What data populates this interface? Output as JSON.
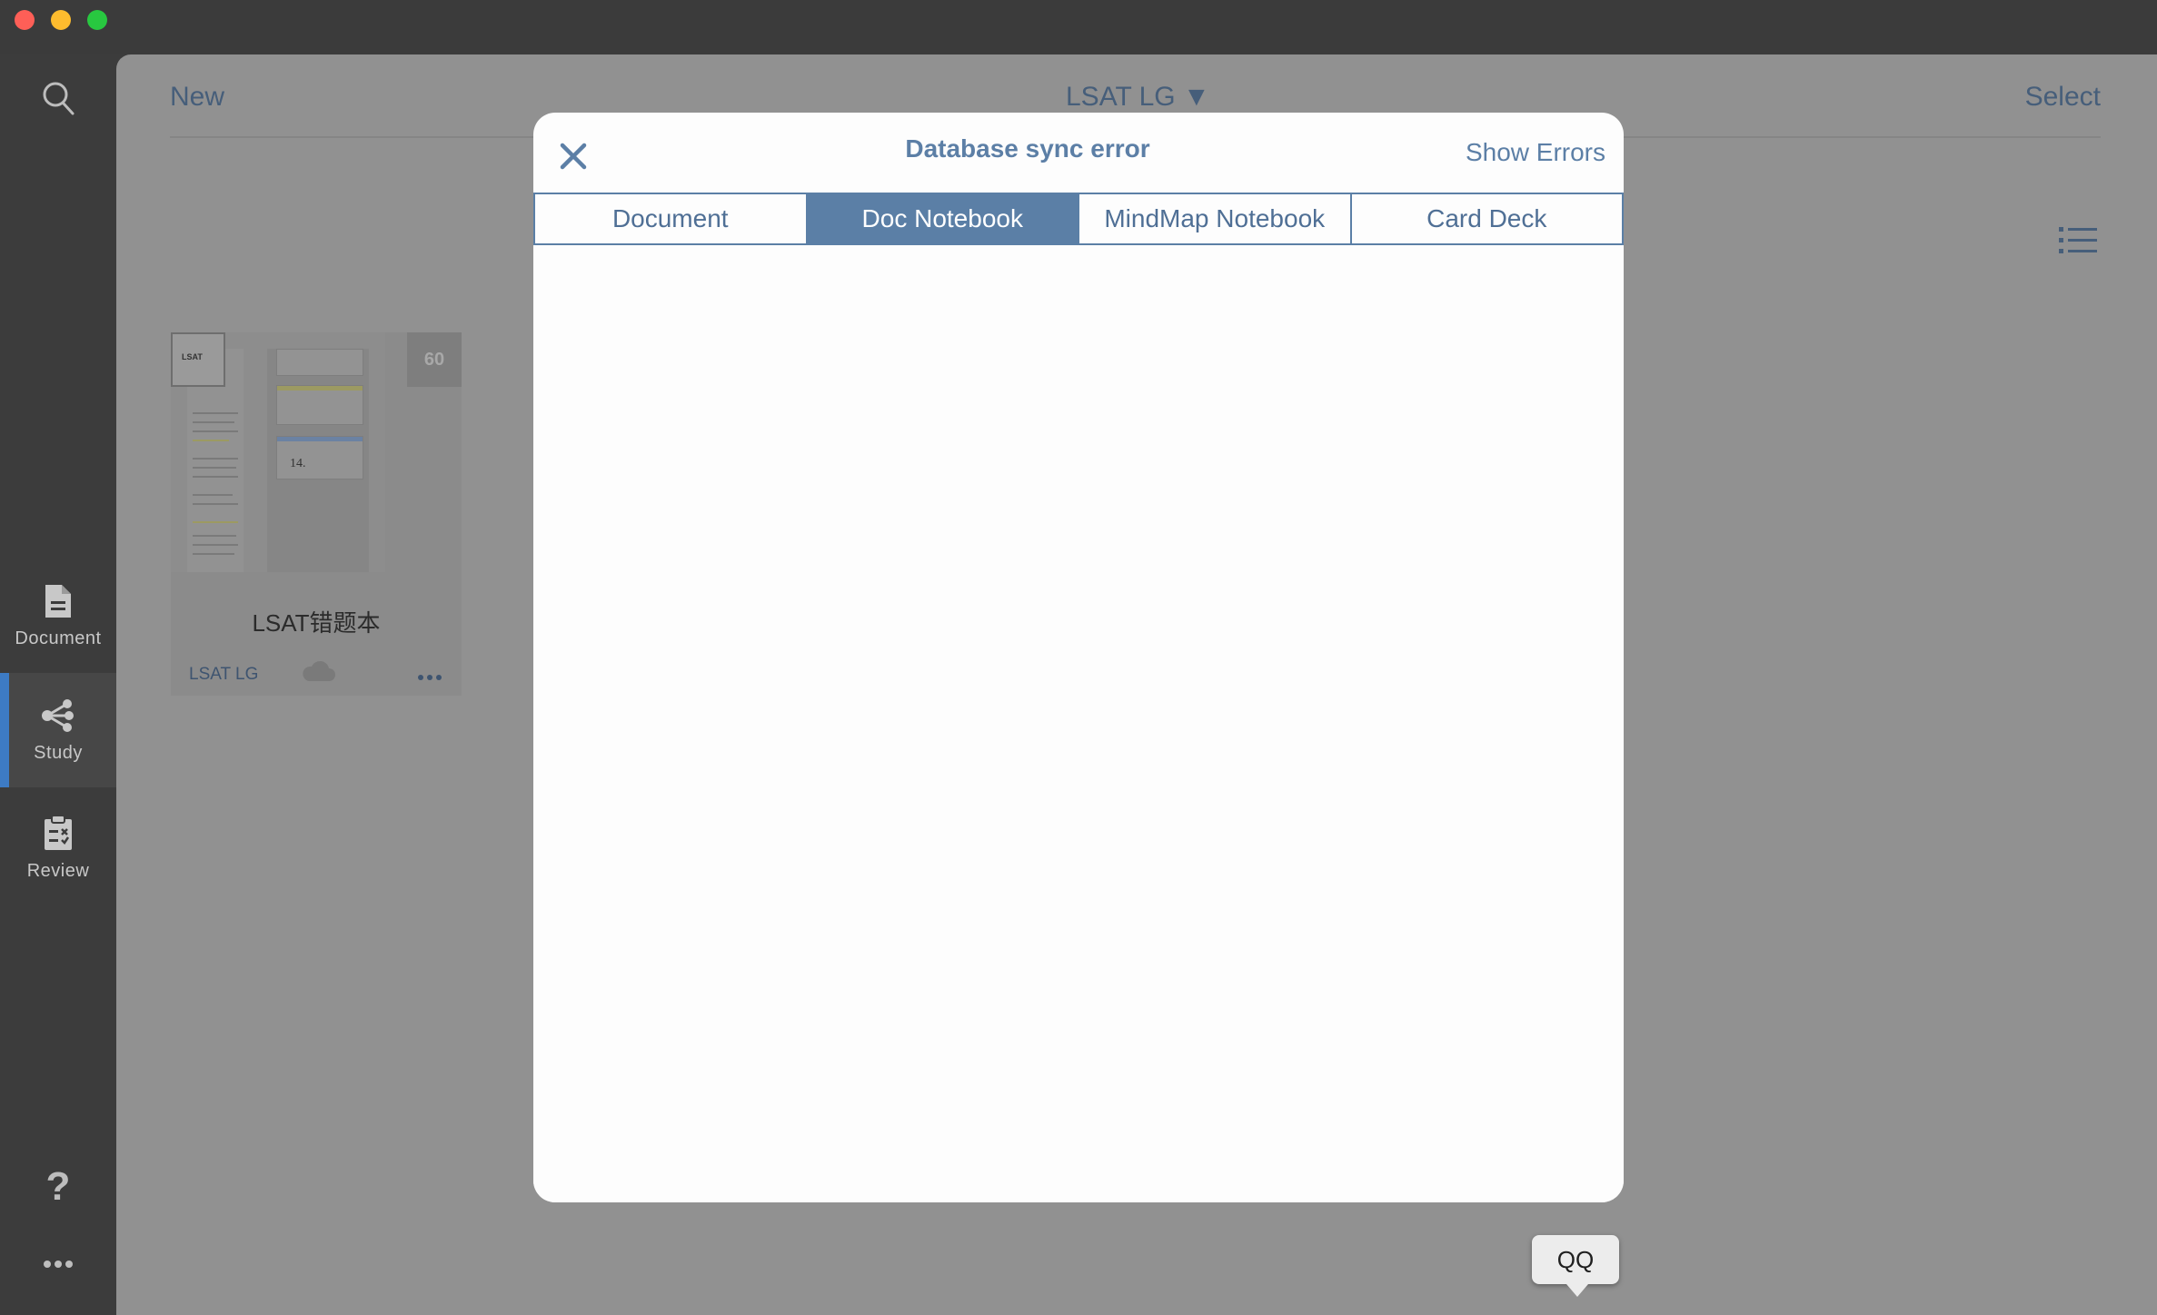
{
  "sidebar": {
    "items": [
      {
        "label": "Document",
        "icon": "document-icon"
      },
      {
        "label": "Study",
        "icon": "study-share-icon"
      },
      {
        "label": "Review",
        "icon": "review-clipboard-icon"
      }
    ],
    "help": "?"
  },
  "toolbar": {
    "new_label": "New",
    "title": "LSAT LG ▼",
    "select_label": "Select"
  },
  "book": {
    "title": "LSAT错题本",
    "tag": "LSAT LG",
    "badge": "60",
    "cover_text": "LSAT",
    "thumb_number": "14."
  },
  "modal": {
    "title": "Database sync error",
    "show_errors": "Show Errors",
    "tabs": [
      {
        "label": "Document"
      },
      {
        "label": "Doc Notebook"
      },
      {
        "label": "MindMap Notebook"
      },
      {
        "label": "Card Deck"
      }
    ],
    "active_tab": "Doc Notebook"
  },
  "tooltip": {
    "text": "QQ"
  },
  "colors": {
    "accent": "#5b7fa6",
    "sidebar_active": "#3d7bc4",
    "dim_overlay": "#919191"
  }
}
